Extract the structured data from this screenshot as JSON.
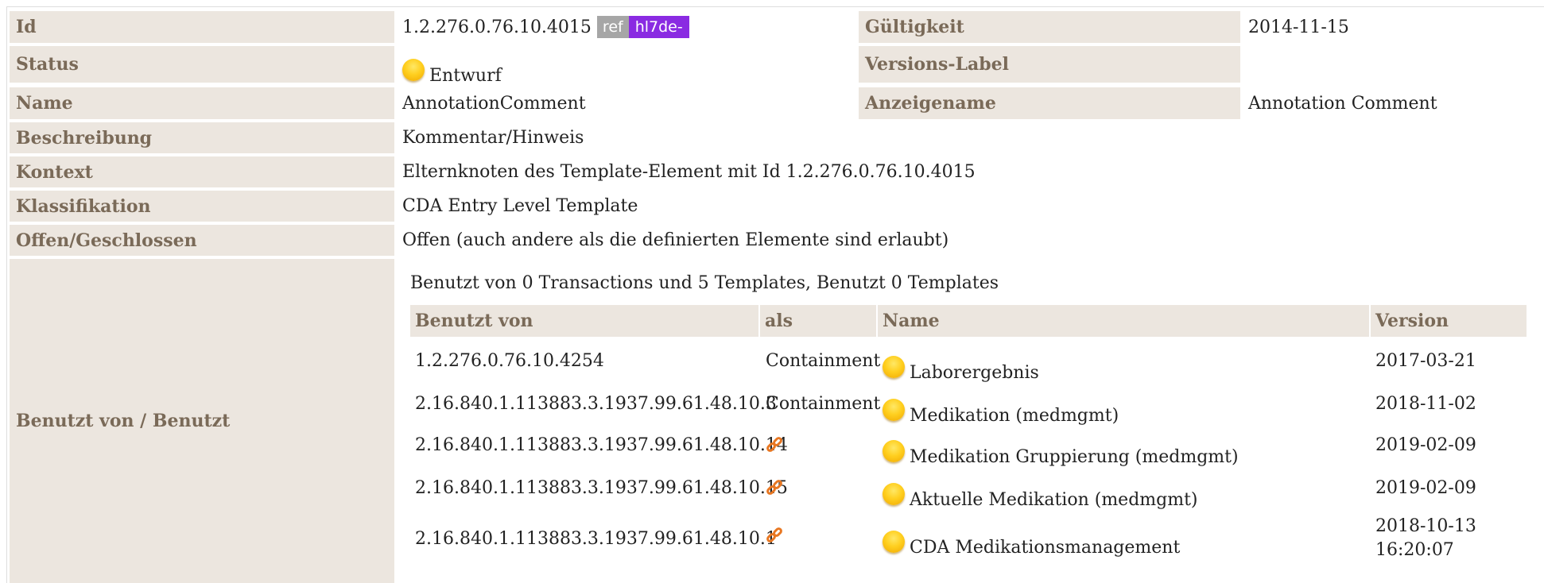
{
  "fields": {
    "id": {
      "label": "Id",
      "value": "1.2.276.0.76.10.4015",
      "ref_badge": "ref",
      "hl7_badge": "hl7de-"
    },
    "gueltigkeit": {
      "label": "Gültigkeit",
      "value": "2014-11-15"
    },
    "status": {
      "label": "Status",
      "value": "Entwurf"
    },
    "versions_label": {
      "label": "Versions-Label",
      "value": ""
    },
    "name": {
      "label": "Name",
      "value": "AnnotationComment"
    },
    "anzeigename": {
      "label": "Anzeigename",
      "value": "Annotation Comment"
    },
    "beschreibung": {
      "label": "Beschreibung",
      "value": "Kommentar/Hinweis"
    },
    "kontext": {
      "label": "Kontext",
      "value": "Elternknoten des Template-Element mit Id 1.2.276.0.76.10.4015"
    },
    "klassifikation": {
      "label": "Klassifikation",
      "value": "CDA Entry Level Template"
    },
    "offen": {
      "label": "Offen/Geschlossen",
      "value": "Offen (auch andere als die definierten Elemente sind erlaubt)"
    },
    "benutzt": {
      "label": "Benutzt von / Benutzt"
    }
  },
  "usage": {
    "summary": "Benutzt von 0 Transactions und 5 Templates, Benutzt 0 Templates",
    "headers": {
      "used_by": "Benutzt von",
      "as": "als",
      "name": "Name",
      "version": "Version"
    },
    "rows": [
      {
        "used_by": "1.2.276.0.76.10.4254",
        "as": "Containment",
        "icon": "",
        "name": "Laborergebnis",
        "version": "2017-03-21"
      },
      {
        "used_by": "2.16.840.1.113883.3.1937.99.61.48.10.3",
        "as": "Containment",
        "icon": "",
        "name": "Medikation (medmgmt)",
        "version": "2018-11-02"
      },
      {
        "used_by": "2.16.840.1.113883.3.1937.99.61.48.10.14",
        "as": "",
        "icon": "link-icon",
        "name": "Medikation Gruppierung (medmgmt)",
        "version": "2019-02-09"
      },
      {
        "used_by": "2.16.840.1.113883.3.1937.99.61.48.10.15",
        "as": "",
        "icon": "link-icon",
        "name": "Aktuelle Medikation (medmgmt)",
        "version": "2019-02-09"
      },
      {
        "used_by": "2.16.840.1.113883.3.1937.99.61.48.10.1",
        "as": "",
        "icon": "link-icon",
        "name": "CDA Medikationsmanagement",
        "version_line1": "2018-10-13",
        "version_line2": "16:20:07"
      }
    ]
  },
  "colors": {
    "label_bg": "#ece6df",
    "label_text": "#7a6a58",
    "status_draft": "#ffcf1f",
    "hl7_badge": "#8a2be2",
    "ref_badge": "#a6a6a6",
    "link_icon": "#e87722"
  }
}
